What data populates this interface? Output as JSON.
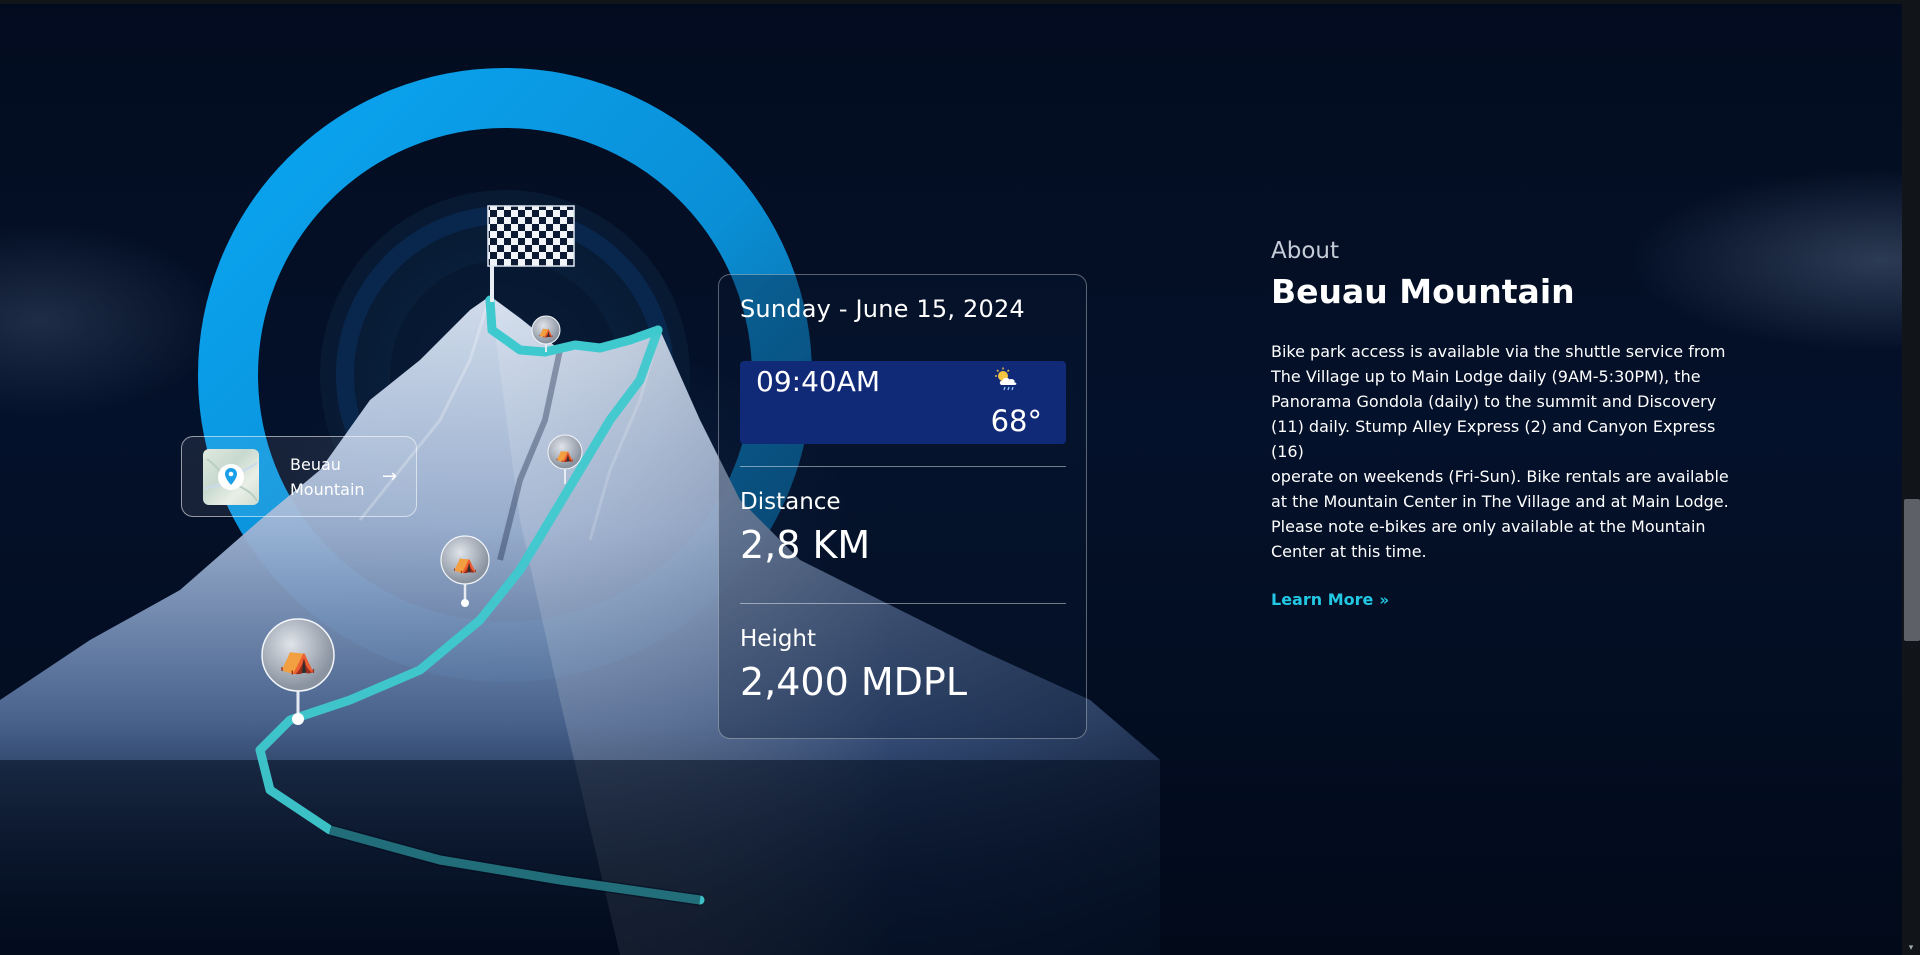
{
  "location_card": {
    "label": "Beuau Mountain",
    "arrow": "→",
    "icon": "map-pin-icon"
  },
  "info_card": {
    "date": "Sunday - June 15, 2024",
    "time": "09:40AM",
    "weather_icon": "partly-cloudy-rain-icon",
    "temperature": "68°",
    "distance_label": "Distance",
    "distance_value": "2,8 KM",
    "height_label": "Height",
    "height_value": "2,400 MDPL"
  },
  "about": {
    "kicker": "About",
    "title": "Beuau Mountain",
    "body_lines": [
      "Bike park access is available via the shuttle service from The Village up to Main Lodge daily (9AM-5:30PM), the Panorama Gondola (daily) to the summit and Discovery (11) daily. Stump Alley Express (2) and Canyon Express (16)",
      "operate on weekends (Fri-Sun). Bike rentals are available",
      "at the Mountain Center in The Village and at Main Lodge.",
      "Please note e-bikes are only available at the Mountain Center at this time."
    ],
    "learn_more": "Learn More",
    "learn_more_icon": "double-chevron-right-icon"
  },
  "colors": {
    "background": "#020b1c",
    "arc": "#0ea3ec",
    "trail": "#3ec9cf",
    "time_box": "#112a78",
    "accent_link": "#21c7e3"
  }
}
